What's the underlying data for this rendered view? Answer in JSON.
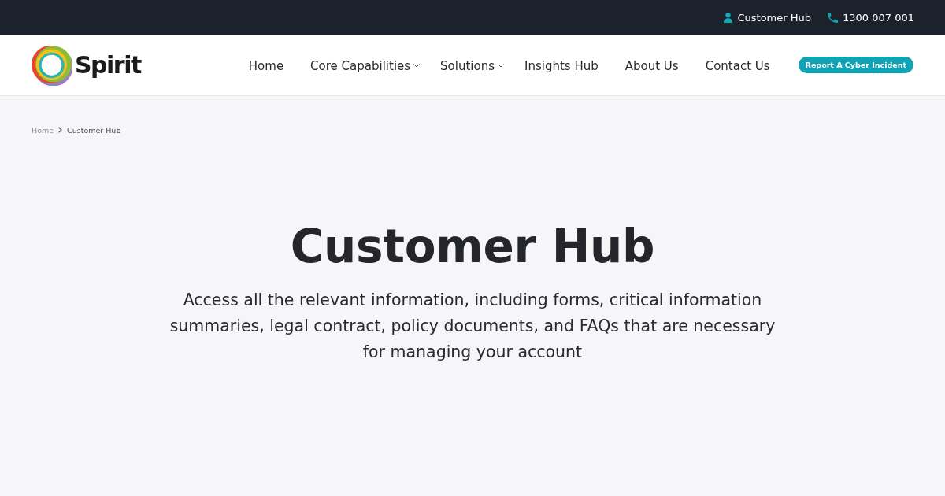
{
  "top_bar": {
    "links": [
      {
        "kind": "account",
        "label": "Customer Hub"
      },
      {
        "kind": "phone",
        "label": "1300 007 001"
      }
    ]
  },
  "header": {
    "logo": {
      "text": "Spirit"
    },
    "nav": [
      {
        "label": "Home",
        "has_dropdown": false
      },
      {
        "label": "Core Capabilities",
        "has_dropdown": true
      },
      {
        "label": "Solutions",
        "has_dropdown": true
      },
      {
        "label": "Insights Hub",
        "has_dropdown": false
      },
      {
        "label": "About Us",
        "has_dropdown": false
      },
      {
        "label": "Contact Us",
        "has_dropdown": false
      }
    ],
    "cta": "Report A Cyber Incident"
  },
  "breadcrumb": [
    {
      "label": "Home",
      "current": false
    },
    {
      "label": "Customer Hub",
      "current": true
    }
  ],
  "hero": {
    "title": "Customer Hub",
    "description": "Access all the relevant information, including forms, critical information summaries, legal contract, policy documents, and FAQs that are necessary for managing your account"
  }
}
